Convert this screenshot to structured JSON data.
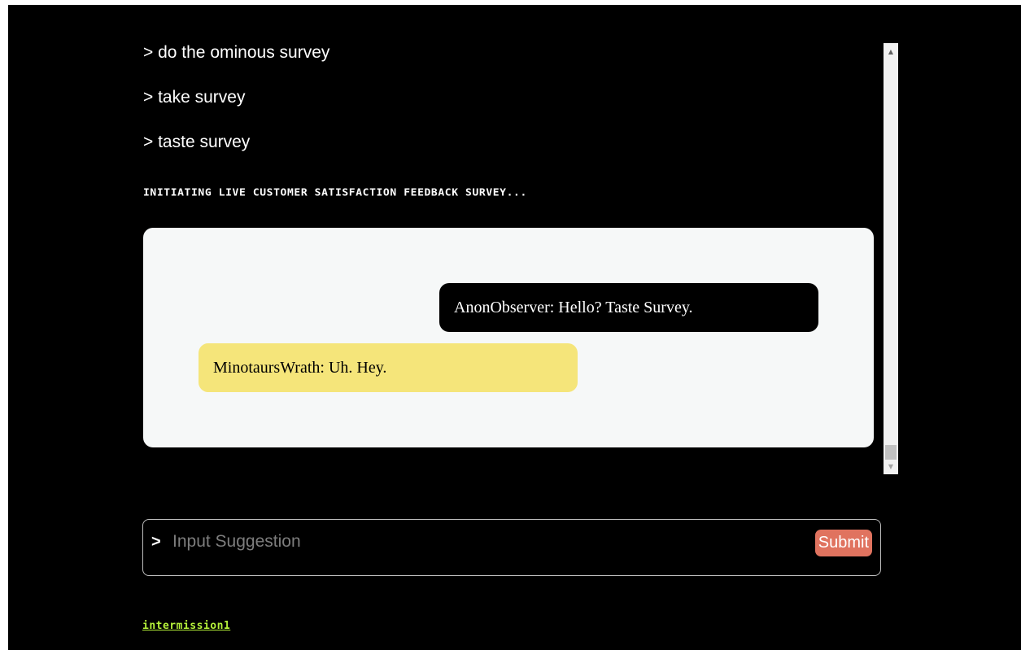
{
  "log": {
    "commands": [
      "> do the ominous survey",
      "> take survey",
      "> taste survey"
    ],
    "system_message": "INITIATING Live customer satisfaction feedback survey..."
  },
  "chat": {
    "messages": [
      {
        "sender": "AnonObserver",
        "text": "AnonObserver: Hello? Taste Survey.",
        "side": "right"
      },
      {
        "sender": "MinotaursWrath",
        "text": "MinotaursWrath: Uh. Hey.",
        "side": "left"
      }
    ]
  },
  "input": {
    "prompt": ">",
    "placeholder": "Input Suggestion",
    "submit_label": "Submit"
  },
  "footer": {
    "link_label": "intermission1"
  },
  "colors": {
    "background": "#000000",
    "chat_panel": "#f6f8f8",
    "outgoing_bubble": "#000000",
    "incoming_bubble": "#f5e57a",
    "submit_button": "#e0735f",
    "footer_link": "#b6f23a"
  },
  "icons": {
    "scroll_up": "triangle-up-icon",
    "scroll_down": "triangle-down-icon"
  }
}
